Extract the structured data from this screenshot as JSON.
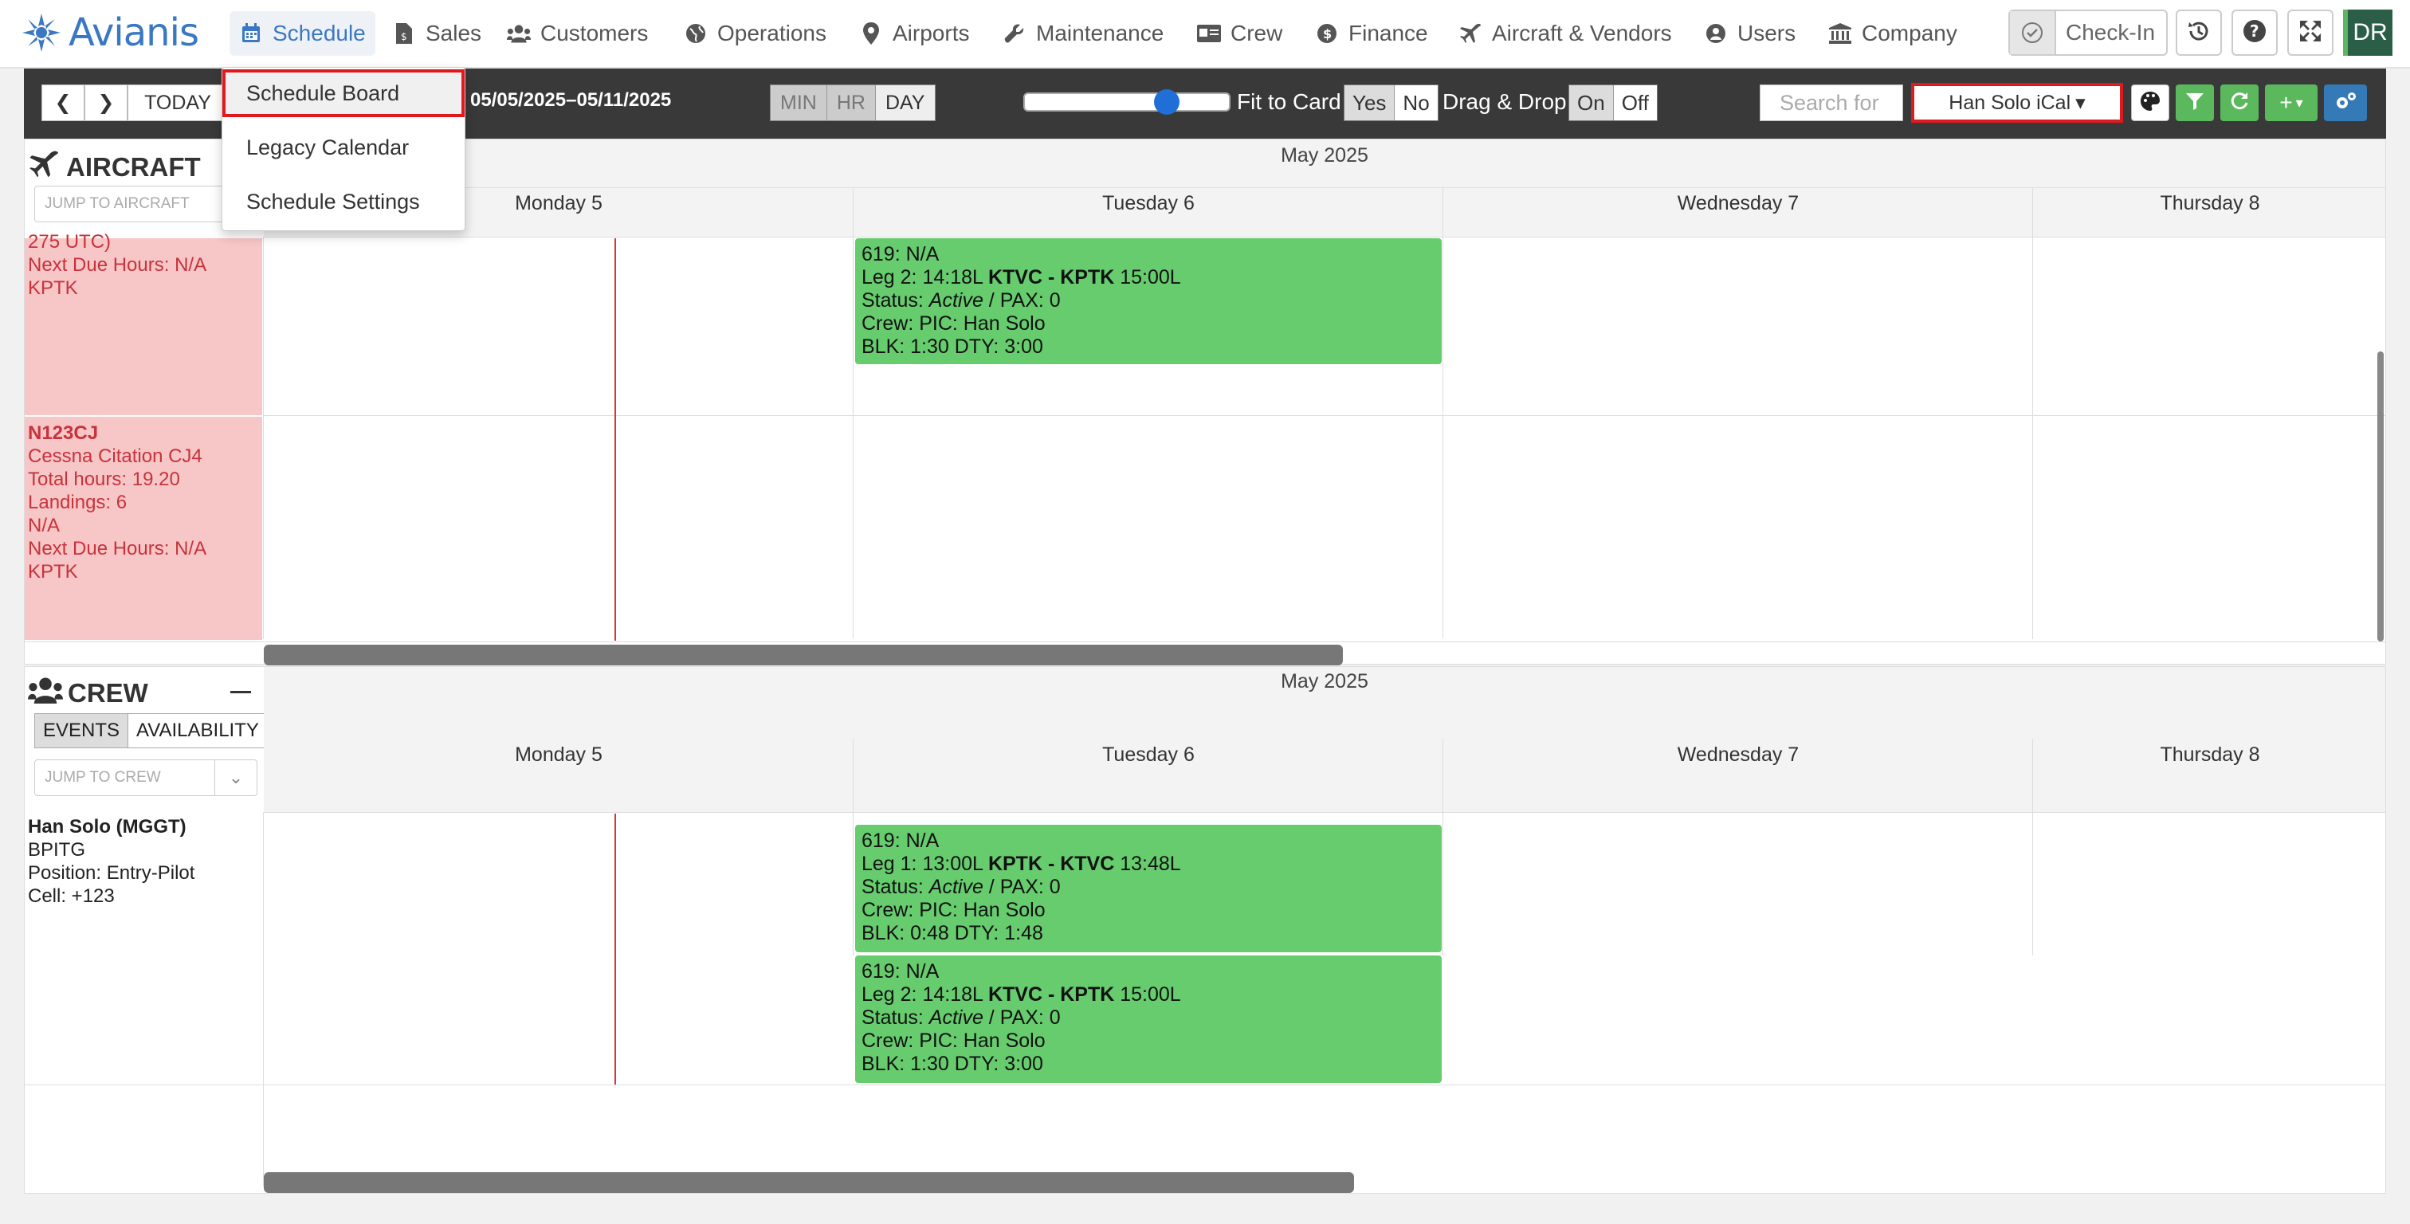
{
  "app": {
    "logo_text": "Avianis"
  },
  "nav": {
    "items": [
      {
        "label": "Schedule",
        "icon": "calendar-icon"
      },
      {
        "label": "Sales",
        "icon": "invoice-icon"
      },
      {
        "label": "Customers",
        "icon": "users-icon"
      },
      {
        "label": "Operations",
        "icon": "globe-icon"
      },
      {
        "label": "Airports",
        "icon": "map-pin-icon"
      },
      {
        "label": "Maintenance",
        "icon": "wrench-icon"
      },
      {
        "label": "Crew",
        "icon": "id-card-icon"
      },
      {
        "label": "Finance",
        "icon": "dollar-icon"
      },
      {
        "label": "Aircraft & Vendors",
        "icon": "plane-icon"
      },
      {
        "label": "Users",
        "icon": "user-circle-icon"
      },
      {
        "label": "Company",
        "icon": "building-icon"
      }
    ],
    "checkin_label": "Check-In",
    "avatar_initials": "DR"
  },
  "schedule_menu": {
    "items": [
      "Schedule Board",
      "Legacy Calendar",
      "Schedule Settings"
    ],
    "selected": "Schedule Board"
  },
  "toolbar": {
    "today_label": "TODAY",
    "date_range": "05/05/2025–05/11/2025",
    "zoom_options": [
      "MIN",
      "HR",
      "DAY"
    ],
    "zoom_selected": "DAY",
    "fit_to_card_label": "Fit to Card",
    "fit_to_card_options": [
      "Yes",
      "No"
    ],
    "fit_to_card_selected": "Yes",
    "drag_drop_label": "Drag & Drop",
    "drag_drop_options": [
      "On",
      "Off"
    ],
    "drag_drop_selected": "On",
    "search_placeholder": "Search for",
    "calendar_feed": "Han Solo iCal",
    "colors": {
      "filter": "#5cb85c",
      "refresh": "#5cb85c",
      "add": "#5cb85c",
      "settings": "#337ab7"
    }
  },
  "aircraft_section": {
    "title": "AIRCRAFT",
    "jump_placeholder": "JUMP TO AIRCRAFT",
    "month": "May 2025",
    "days": [
      "Monday 5",
      "Tuesday 6",
      "Wednesday 7",
      "Thursday 8"
    ],
    "rows": [
      {
        "lines": [
          "275 UTC)",
          "Next Due Hours: N/A",
          "KPTK"
        ]
      },
      {
        "tail": "N123CJ",
        "lines": [
          "Cessna Citation CJ4",
          "Total hours: 19.20",
          "Landings: 6",
          "N/A",
          "Next Due Hours: N/A",
          "KPTK"
        ]
      }
    ],
    "events": [
      {
        "trip": "619: N/A",
        "leg_prefix": "Leg 2: 14:18L ",
        "route": "KTVC - KPTK",
        "leg_suffix": " 15:00L",
        "status_prefix": "Status: ",
        "status": "Active",
        "pax": " / PAX: 0",
        "crew": "Crew: PIC: Han Solo",
        "times": "BLK: 1:30 DTY: 3:00"
      }
    ]
  },
  "crew_section": {
    "title": "CREW",
    "tabs": [
      "EVENTS",
      "AVAILABILITY"
    ],
    "tab_selected": "EVENTS",
    "jump_placeholder": "JUMP TO CREW",
    "month": "May 2025",
    "days": [
      "Monday 5",
      "Tuesday 6",
      "Wednesday 7",
      "Thursday 8"
    ],
    "member": {
      "name": "Han Solo (MGGT)",
      "base": "BPITG",
      "position": "Position: Entry-Pilot",
      "cell": "Cell: +123"
    },
    "events": [
      {
        "trip": "619: N/A",
        "leg_prefix": "Leg 1: 13:00L ",
        "route": "KPTK - KTVC",
        "leg_suffix": " 13:48L",
        "status_prefix": "Status: ",
        "status": "Active",
        "pax": " / PAX: 0",
        "crew": "Crew: PIC: Han Solo",
        "times": "BLK: 0:48 DTY: 1:48"
      },
      {
        "trip": "619: N/A",
        "leg_prefix": "Leg 2: 14:18L ",
        "route": "KTVC - KPTK",
        "leg_suffix": " 15:00L",
        "status_prefix": "Status: ",
        "status": "Active",
        "pax": " / PAX: 0",
        "crew": "Crew: PIC: Han Solo",
        "times": "BLK: 1:30 DTY: 3:00"
      }
    ]
  }
}
